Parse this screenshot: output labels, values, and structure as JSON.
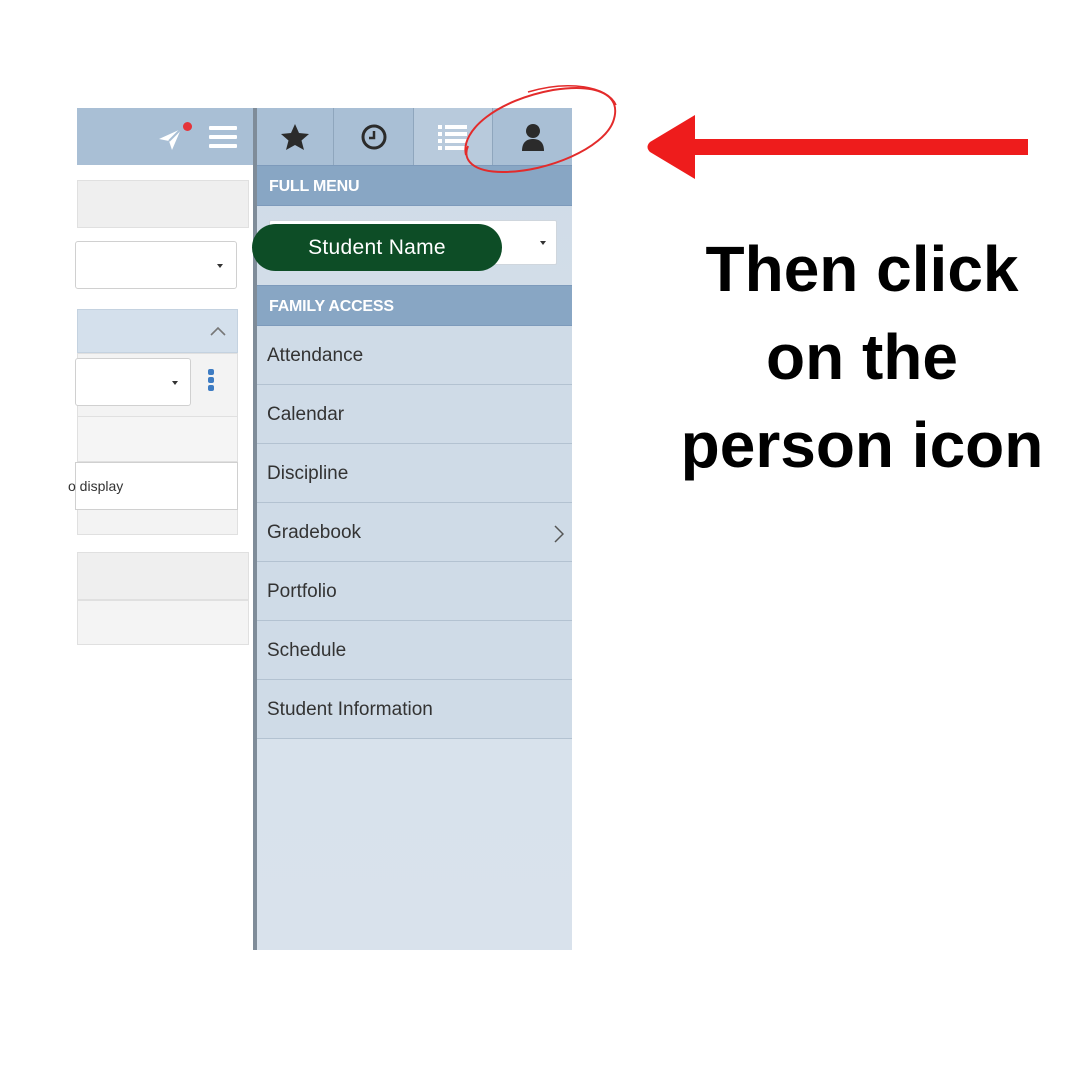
{
  "left_panel": {
    "partial_text": "o display"
  },
  "menu_panel": {
    "tabs": [
      {
        "icon": "star-icon"
      },
      {
        "icon": "clock-icon"
      },
      {
        "icon": "list-icon"
      },
      {
        "icon": "person-icon"
      }
    ],
    "full_menu_header": "FULL MENU",
    "student_select_label": "Student Name",
    "family_access_header": "FAMILY ACCESS",
    "items": [
      {
        "label": "Attendance"
      },
      {
        "label": "Calendar"
      },
      {
        "label": "Discipline"
      },
      {
        "label": "Gradebook",
        "has_submenu": true
      },
      {
        "label": "Portfolio"
      },
      {
        "label": "Schedule"
      },
      {
        "label": "Student Information"
      }
    ]
  },
  "annotation": {
    "instruction_lines": [
      "Then click",
      "on the",
      "person icon"
    ],
    "colors": {
      "arrow": "#ee1c1c",
      "circle": "#e32b2b",
      "pill": "#0d4d26",
      "menu_header": "#88a6c4"
    }
  }
}
